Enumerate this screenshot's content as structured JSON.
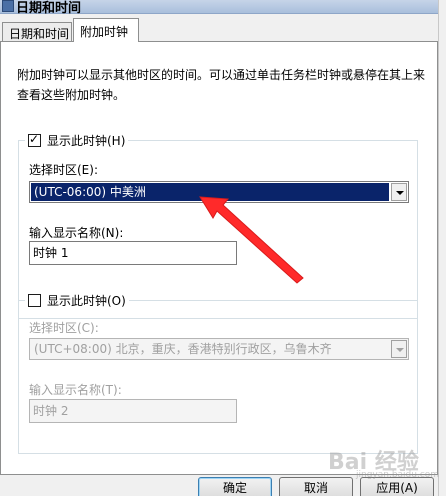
{
  "window": {
    "title": "日期和时间"
  },
  "tabs": [
    {
      "label": "日期和时间",
      "active": false
    },
    {
      "label": "附加时钟",
      "active": true
    }
  ],
  "description": "附加时钟可以显示其他时区的时间。可以通过单击任务栏时钟或悬停在其上来查看这些附加时钟。",
  "clock1": {
    "show_label": "显示此时钟(H)",
    "checked": true,
    "check_mark": "✓",
    "timezone_label": "选择时区(E):",
    "timezone_value": "(UTC-06:00) 中美洲",
    "name_label": "输入显示名称(N):",
    "name_value": "时钟 1"
  },
  "clock2": {
    "show_label": "显示此时钟(O)",
    "checked": false,
    "timezone_label": "选择时区(C):",
    "timezone_value": "(UTC+08:00) 北京，重庆，香港特别行政区，乌鲁木齐",
    "name_label": "输入显示名称(T):",
    "name_value": "时钟 2"
  },
  "buttons": {
    "ok": "确定",
    "cancel": "取消",
    "apply": "应用(A)"
  },
  "watermark": {
    "text": "Bai 经验",
    "sub": "jingyan.baidu.com"
  },
  "colors": {
    "selection": "#0a246a",
    "annotation_arrow": "#ff2a2a"
  }
}
